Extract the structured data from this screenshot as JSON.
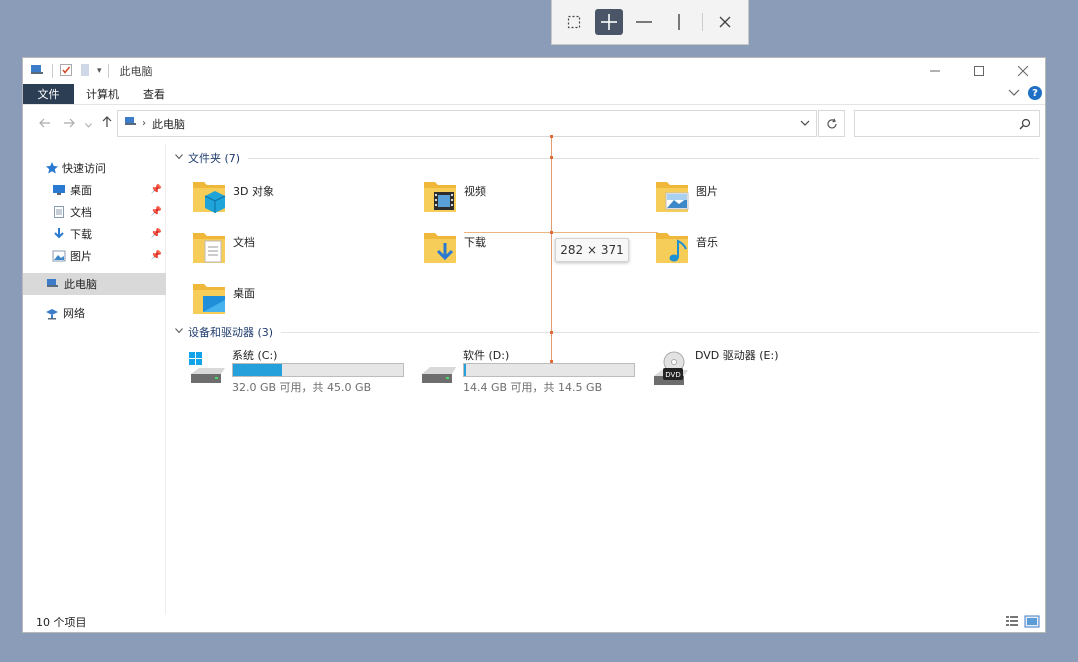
{
  "measure_toolbar": {
    "tools": [
      "selection-tool",
      "crosshair-tool",
      "horizontal-tool",
      "vertical-tool",
      "close-tool"
    ],
    "active": "crosshair-tool"
  },
  "window": {
    "title": "此电脑",
    "controls": [
      "minimize",
      "maximize",
      "close"
    ]
  },
  "ribbon": {
    "tabs": [
      "文件",
      "计算机",
      "查看"
    ],
    "help_label": "?"
  },
  "address": {
    "path": "此电脑",
    "search_placeholder": ""
  },
  "nav_pane": {
    "items": [
      {
        "label": "快速访问",
        "icon": "star-icon"
      },
      {
        "label": "桌面",
        "icon": "desktop-icon",
        "pinned": true
      },
      {
        "label": "文档",
        "icon": "document-icon",
        "pinned": true
      },
      {
        "label": "下载",
        "icon": "download-icon",
        "pinned": true
      },
      {
        "label": "图片",
        "icon": "picture-icon",
        "pinned": true
      },
      {
        "label": "此电脑",
        "icon": "computer-icon",
        "selected": true
      },
      {
        "label": "网络",
        "icon": "network-icon"
      }
    ]
  },
  "folders_group": {
    "header": "文件夹 (7)",
    "items": [
      {
        "label": "3D 对象",
        "icon": "3d-objects-icon"
      },
      {
        "label": "视频",
        "icon": "video-icon"
      },
      {
        "label": "图片",
        "icon": "picture-folder-icon"
      },
      {
        "label": "文档",
        "icon": "document-folder-icon"
      },
      {
        "label": "下载",
        "icon": "download-folder-icon"
      },
      {
        "label": "音乐",
        "icon": "music-folder-icon"
      },
      {
        "label": "桌面",
        "icon": "desktop-folder-icon"
      }
    ]
  },
  "drives_group": {
    "header": "设备和驱动器 (3)",
    "items": [
      {
        "label": "系统 (C:)",
        "size": "32.0 GB 可用，共 45.0 GB",
        "used_fraction": 0.289,
        "icon": "windows-drive-icon"
      },
      {
        "label": "软件 (D:)",
        "size": "14.4 GB 可用，共 14.5 GB",
        "used_fraction": 0.007,
        "icon": "hard-drive-icon"
      },
      {
        "label": "DVD 驱动器 (E:)",
        "icon": "dvd-drive-icon"
      }
    ]
  },
  "status": {
    "count": "10 个项目"
  },
  "measurement": {
    "label": "282 × 371"
  },
  "colors": {
    "accent": "#26a0da",
    "file_tab": "#2c3e54",
    "folder": "#f5c84a",
    "guide": "#e08a5a"
  }
}
